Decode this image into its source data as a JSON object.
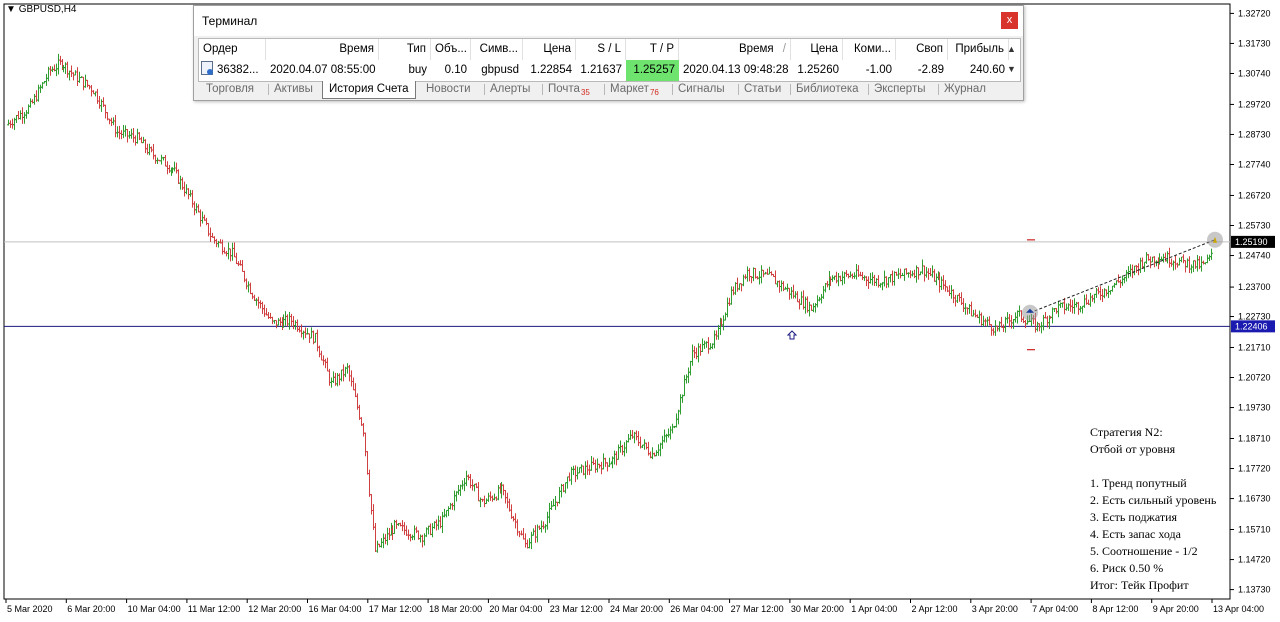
{
  "symbol_label": "GBPUSD,H4",
  "terminal": {
    "title": "Терминал",
    "close_label": "x",
    "columns": [
      "Ордер",
      "Время",
      "Тип",
      "Объ...",
      "Симв...",
      "Цена",
      "S / L",
      "T / P",
      "Время",
      "Цена",
      "Коми...",
      "Своп",
      "Прибыль"
    ],
    "sort_indicator": "/",
    "row": {
      "order": "36382...",
      "open_time": "2020.04.07 08:55:00",
      "type": "buy",
      "volume": "0.10",
      "symbol": "gbpusd",
      "open_price": "1.22854",
      "sl": "1.21637",
      "tp": "1.25257",
      "close_time": "2020.04.13 09:48:28",
      "close_price": "1.25260",
      "commission": "-1.00",
      "swap": "-2.89",
      "profit": "240.60"
    },
    "tabs": [
      {
        "label": "Торговля",
        "badge": ""
      },
      {
        "label": "Активы",
        "badge": ""
      },
      {
        "label": "История Счета",
        "badge": "",
        "active": true
      },
      {
        "label": "Новости",
        "badge": ""
      },
      {
        "label": "Алерты",
        "badge": ""
      },
      {
        "label": "Почта",
        "badge": "35"
      },
      {
        "label": "Маркет",
        "badge": "76"
      },
      {
        "label": "Сигналы",
        "badge": ""
      },
      {
        "label": "Статьи",
        "badge": ""
      },
      {
        "label": "Библиотека",
        "badge": ""
      },
      {
        "label": "Эксперты",
        "badge": ""
      },
      {
        "label": "Журнал",
        "badge": ""
      }
    ]
  },
  "strategy": {
    "lines": [
      "Стратегия N2:",
      "Отбой от уровня",
      "",
      "1. Тренд попутный",
      "2. Есть сильный уровень",
      "3. Есть поджатия",
      "4. Есть запас хода",
      "5. Соотношение - 1/2",
      "6. Риск 0.50 %",
      "Итог: Тейк Профит"
    ]
  },
  "chart_data": {
    "type": "ohlc",
    "symbol": "GBPUSD",
    "timeframe": "H4",
    "y_ticks": [
      "1.32720",
      "1.31730",
      "1.30740",
      "1.29720",
      "1.28730",
      "1.27740",
      "1.26720",
      "1.25730",
      "1.24740",
      "1.23700",
      "1.22730",
      "1.21710",
      "1.20720",
      "1.19730",
      "1.18710",
      "1.17720",
      "1.16730",
      "1.15710",
      "1.14720",
      "1.13730"
    ],
    "x_ticks": [
      "5 Mar 2020",
      "6 Mar 20:00",
      "10 Mar 04:00",
      "11 Mar 12:00",
      "12 Mar 20:00",
      "16 Mar 04:00",
      "17 Mar 12:00",
      "18 Mar 20:00",
      "20 Mar 04:00",
      "23 Mar 12:00",
      "24 Mar 20:00",
      "26 Mar 04:00",
      "27 Mar 12:00",
      "30 Mar 20:00",
      "1 Apr 04:00",
      "2 Apr 12:00",
      "3 Apr 20:00",
      "7 Apr 04:00",
      "8 Apr 12:00",
      "9 Apr 20:00",
      "13 Apr 04:00"
    ],
    "ylim": [
      1.1342,
      1.3303
    ],
    "horizontal_lines": [
      {
        "price": 1.2519,
        "label": "1.25190",
        "color": "#c0c0c0",
        "tag_bg": "#000000"
      },
      {
        "price": 1.22406,
        "label": "1.22406",
        "color": "#1a1a80",
        "tag_bg": "#1a1ab0"
      }
    ],
    "trade": {
      "open_price": 1.22854,
      "close_price": 1.2526,
      "sl": 1.21637,
      "tp": 1.25257
    },
    "bull_color": "#2e9c2e",
    "bear_color": "#d04040"
  }
}
